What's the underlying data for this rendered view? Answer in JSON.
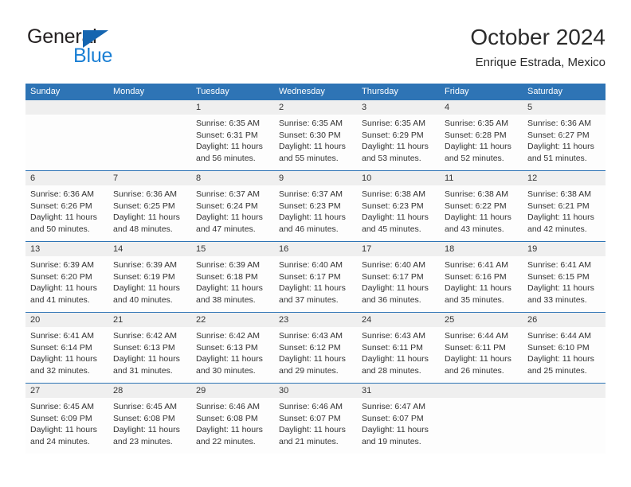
{
  "brand": {
    "name_part1": "General",
    "name_part2": "Blue",
    "triangle_icon": "blue-triangle-icon"
  },
  "header": {
    "title": "October 2024",
    "subtitle": "Enrique Estrada, Mexico"
  },
  "colors": {
    "header_blue": "#2e74b5",
    "brand_blue": "#1a7fd4",
    "triangle_blue": "#1565b0",
    "day_number_band": "#efefef",
    "text": "#333333"
  },
  "weekdays": [
    "Sunday",
    "Monday",
    "Tuesday",
    "Wednesday",
    "Thursday",
    "Friday",
    "Saturday"
  ],
  "labels": {
    "sunrise": "Sunrise:",
    "sunset": "Sunset:",
    "daylight": "Daylight:"
  },
  "weeks": [
    [
      {
        "day": "",
        "empty": true
      },
      {
        "day": "",
        "empty": true
      },
      {
        "day": "1",
        "sunrise": "Sunrise: 6:35 AM",
        "sunset": "Sunset: 6:31 PM",
        "daylight1": "Daylight: 11 hours",
        "daylight2": "and 56 minutes."
      },
      {
        "day": "2",
        "sunrise": "Sunrise: 6:35 AM",
        "sunset": "Sunset: 6:30 PM",
        "daylight1": "Daylight: 11 hours",
        "daylight2": "and 55 minutes."
      },
      {
        "day": "3",
        "sunrise": "Sunrise: 6:35 AM",
        "sunset": "Sunset: 6:29 PM",
        "daylight1": "Daylight: 11 hours",
        "daylight2": "and 53 minutes."
      },
      {
        "day": "4",
        "sunrise": "Sunrise: 6:35 AM",
        "sunset": "Sunset: 6:28 PM",
        "daylight1": "Daylight: 11 hours",
        "daylight2": "and 52 minutes."
      },
      {
        "day": "5",
        "sunrise": "Sunrise: 6:36 AM",
        "sunset": "Sunset: 6:27 PM",
        "daylight1": "Daylight: 11 hours",
        "daylight2": "and 51 minutes."
      }
    ],
    [
      {
        "day": "6",
        "sunrise": "Sunrise: 6:36 AM",
        "sunset": "Sunset: 6:26 PM",
        "daylight1": "Daylight: 11 hours",
        "daylight2": "and 50 minutes."
      },
      {
        "day": "7",
        "sunrise": "Sunrise: 6:36 AM",
        "sunset": "Sunset: 6:25 PM",
        "daylight1": "Daylight: 11 hours",
        "daylight2": "and 48 minutes."
      },
      {
        "day": "8",
        "sunrise": "Sunrise: 6:37 AM",
        "sunset": "Sunset: 6:24 PM",
        "daylight1": "Daylight: 11 hours",
        "daylight2": "and 47 minutes."
      },
      {
        "day": "9",
        "sunrise": "Sunrise: 6:37 AM",
        "sunset": "Sunset: 6:23 PM",
        "daylight1": "Daylight: 11 hours",
        "daylight2": "and 46 minutes."
      },
      {
        "day": "10",
        "sunrise": "Sunrise: 6:38 AM",
        "sunset": "Sunset: 6:23 PM",
        "daylight1": "Daylight: 11 hours",
        "daylight2": "and 45 minutes."
      },
      {
        "day": "11",
        "sunrise": "Sunrise: 6:38 AM",
        "sunset": "Sunset: 6:22 PM",
        "daylight1": "Daylight: 11 hours",
        "daylight2": "and 43 minutes."
      },
      {
        "day": "12",
        "sunrise": "Sunrise: 6:38 AM",
        "sunset": "Sunset: 6:21 PM",
        "daylight1": "Daylight: 11 hours",
        "daylight2": "and 42 minutes."
      }
    ],
    [
      {
        "day": "13",
        "sunrise": "Sunrise: 6:39 AM",
        "sunset": "Sunset: 6:20 PM",
        "daylight1": "Daylight: 11 hours",
        "daylight2": "and 41 minutes."
      },
      {
        "day": "14",
        "sunrise": "Sunrise: 6:39 AM",
        "sunset": "Sunset: 6:19 PM",
        "daylight1": "Daylight: 11 hours",
        "daylight2": "and 40 minutes."
      },
      {
        "day": "15",
        "sunrise": "Sunrise: 6:39 AM",
        "sunset": "Sunset: 6:18 PM",
        "daylight1": "Daylight: 11 hours",
        "daylight2": "and 38 minutes."
      },
      {
        "day": "16",
        "sunrise": "Sunrise: 6:40 AM",
        "sunset": "Sunset: 6:17 PM",
        "daylight1": "Daylight: 11 hours",
        "daylight2": "and 37 minutes."
      },
      {
        "day": "17",
        "sunrise": "Sunrise: 6:40 AM",
        "sunset": "Sunset: 6:17 PM",
        "daylight1": "Daylight: 11 hours",
        "daylight2": "and 36 minutes."
      },
      {
        "day": "18",
        "sunrise": "Sunrise: 6:41 AM",
        "sunset": "Sunset: 6:16 PM",
        "daylight1": "Daylight: 11 hours",
        "daylight2": "and 35 minutes."
      },
      {
        "day": "19",
        "sunrise": "Sunrise: 6:41 AM",
        "sunset": "Sunset: 6:15 PM",
        "daylight1": "Daylight: 11 hours",
        "daylight2": "and 33 minutes."
      }
    ],
    [
      {
        "day": "20",
        "sunrise": "Sunrise: 6:41 AM",
        "sunset": "Sunset: 6:14 PM",
        "daylight1": "Daylight: 11 hours",
        "daylight2": "and 32 minutes."
      },
      {
        "day": "21",
        "sunrise": "Sunrise: 6:42 AM",
        "sunset": "Sunset: 6:13 PM",
        "daylight1": "Daylight: 11 hours",
        "daylight2": "and 31 minutes."
      },
      {
        "day": "22",
        "sunrise": "Sunrise: 6:42 AM",
        "sunset": "Sunset: 6:13 PM",
        "daylight1": "Daylight: 11 hours",
        "daylight2": "and 30 minutes."
      },
      {
        "day": "23",
        "sunrise": "Sunrise: 6:43 AM",
        "sunset": "Sunset: 6:12 PM",
        "daylight1": "Daylight: 11 hours",
        "daylight2": "and 29 minutes."
      },
      {
        "day": "24",
        "sunrise": "Sunrise: 6:43 AM",
        "sunset": "Sunset: 6:11 PM",
        "daylight1": "Daylight: 11 hours",
        "daylight2": "and 28 minutes."
      },
      {
        "day": "25",
        "sunrise": "Sunrise: 6:44 AM",
        "sunset": "Sunset: 6:11 PM",
        "daylight1": "Daylight: 11 hours",
        "daylight2": "and 26 minutes."
      },
      {
        "day": "26",
        "sunrise": "Sunrise: 6:44 AM",
        "sunset": "Sunset: 6:10 PM",
        "daylight1": "Daylight: 11 hours",
        "daylight2": "and 25 minutes."
      }
    ],
    [
      {
        "day": "27",
        "sunrise": "Sunrise: 6:45 AM",
        "sunset": "Sunset: 6:09 PM",
        "daylight1": "Daylight: 11 hours",
        "daylight2": "and 24 minutes."
      },
      {
        "day": "28",
        "sunrise": "Sunrise: 6:45 AM",
        "sunset": "Sunset: 6:08 PM",
        "daylight1": "Daylight: 11 hours",
        "daylight2": "and 23 minutes."
      },
      {
        "day": "29",
        "sunrise": "Sunrise: 6:46 AM",
        "sunset": "Sunset: 6:08 PM",
        "daylight1": "Daylight: 11 hours",
        "daylight2": "and 22 minutes."
      },
      {
        "day": "30",
        "sunrise": "Sunrise: 6:46 AM",
        "sunset": "Sunset: 6:07 PM",
        "daylight1": "Daylight: 11 hours",
        "daylight2": "and 21 minutes."
      },
      {
        "day": "31",
        "sunrise": "Sunrise: 6:47 AM",
        "sunset": "Sunset: 6:07 PM",
        "daylight1": "Daylight: 11 hours",
        "daylight2": "and 19 minutes."
      },
      {
        "day": "",
        "empty": true
      },
      {
        "day": "",
        "empty": true
      }
    ]
  ]
}
